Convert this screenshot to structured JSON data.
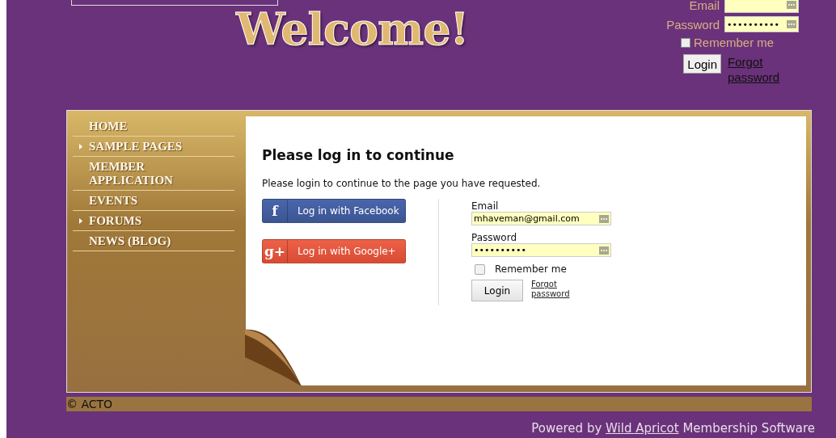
{
  "header": {
    "title": "Welcome!",
    "login": {
      "email_label": "Email",
      "password_label": "Password",
      "password_value": "••••••••••",
      "remember_label": "Remember me",
      "remember_checked": false,
      "login_button": "Login",
      "forgot_link": "Forgot password"
    }
  },
  "menu": [
    {
      "label": "HOME",
      "has_submenu": false
    },
    {
      "label": "SAMPLE PAGES",
      "has_submenu": true
    },
    {
      "label": "MEMBER APPLICATION",
      "has_submenu": false
    },
    {
      "label": "EVENTS",
      "has_submenu": false
    },
    {
      "label": "FORUMS",
      "has_submenu": true
    },
    {
      "label": "NEWS (BLOG)",
      "has_submenu": false
    }
  ],
  "content": {
    "heading": "Please log in to continue",
    "intro": "Please login to continue to the page you have requested.",
    "social": [
      {
        "kind": "facebook",
        "icon": "f",
        "label": "Log in with Facebook"
      },
      {
        "kind": "google",
        "icon": "g+",
        "label": "Log in with Google+"
      }
    ],
    "form": {
      "email_label": "Email",
      "email_value": "mhaveman@gmail.com",
      "password_label": "Password",
      "password_value": "••••••••••",
      "remember_label": "Remember me",
      "remember_checked": false,
      "login_button": "Login",
      "forgot_link": "Forgot password"
    }
  },
  "footer": {
    "copyright": "© ACTO",
    "powered_prefix": "Powered by",
    "powered_link": "Wild Apricot",
    "powered_suffix": "Membership Software"
  }
}
